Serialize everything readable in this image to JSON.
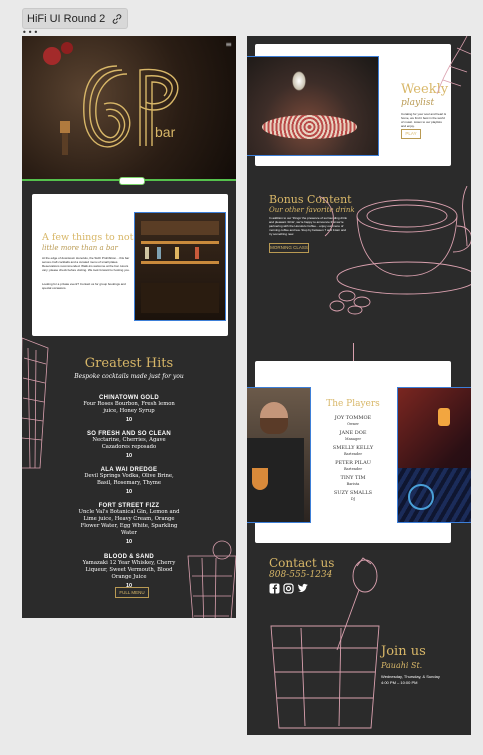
{
  "editor": {
    "frame_name": "HiFi UI Round 2",
    "frame_dots": "•••",
    "link_icon": "link-icon"
  },
  "artboard1": {
    "hero": {
      "logo": "6P",
      "bar_word": "bar"
    },
    "note_card": {
      "title": "A few things to note",
      "subtitle": "little more than a bar",
      "body": "At the edge of downtown Honolulu, the Sixth Prohibition... this bar serves craft cocktails and a curated menu of small plates. Reservations recommended. Walk-ins welcome at the bar. Hours vary; please check before visiting. We look forward to hosting you.",
      "body2": "Looking for a private event? Contact us for group bookings and special occasions."
    },
    "greatest_hits": {
      "title": "Greatest Hits",
      "subtitle": "Bespoke cocktails made just for you",
      "items": [
        {
          "name": "CHINATOWN GOLD",
          "desc": "Four Roses Bourbon, Fresh lemon juice, Honey Syrup",
          "price": "10"
        },
        {
          "name": "SO FRESH AND SO CLEAN",
          "desc": "Nectarine, Cherries, Agave Cazadores reposado",
          "price": "10"
        },
        {
          "name": "ALA WAI DREDGE",
          "desc": "Devil Springs Vodka, Olive Brine, Basil, Rosemary, Thyme",
          "price": "10"
        },
        {
          "name": "FORT STREET FIZZ",
          "desc": "Uncle Val's Botanical Gin, Lemon and Lime juice, Heavy Cream, Orange Flower Water, Egg White, Sparkling Water",
          "price": "10"
        },
        {
          "name": "BLOOD & SAND",
          "desc": "Yamazaki 12 Year Whiskey, Cherry Liqueur, Sweet Vermouth, Blood Orange Juice",
          "price": "10"
        }
      ],
      "button": "FULL MENU"
    }
  },
  "artboard2": {
    "weekly": {
      "title": "Weekly",
      "subtitle": "playlist",
      "body": "Curating for your soul and heart & home, we find it best in the world of music. Listen to our playlists and enjoy.",
      "button": "PLAY"
    },
    "bonus": {
      "title": "Bonus Content",
      "subtitle": "Our other favorite drink",
      "body": "In addition to our 'things' the presence of surrounding drink and pleasant 'drink', we're happy to announce that we're partnering with the Honolulu Coffee... enjoy our menu of morning coffee and tea. Stop by between 7 and 11am and try something new.",
      "button": "MORNING CLASS"
    },
    "players": {
      "title": "The Players",
      "list": [
        {
          "name": "JOY TOMMOE",
          "role": "Owner"
        },
        {
          "name": "JANE DOE",
          "role": "Manager"
        },
        {
          "name": "SMELLY KELLY",
          "role": "Bartender"
        },
        {
          "name": "PETER PILAU",
          "role": "Bartender"
        },
        {
          "name": "TINY TIM",
          "role": "Barista"
        },
        {
          "name": "SUZY SMALLS",
          "role": "DJ"
        }
      ]
    },
    "contact": {
      "title": "Contact us",
      "phone": "808-555-1234",
      "icons": [
        "facebook-icon",
        "instagram-icon",
        "twitter-icon"
      ]
    },
    "join": {
      "title": "Join us",
      "place": "Pauahi St.",
      "days": "Wednesday, Thursday, & Sunday",
      "hours": "4:00 PM – 10:00 PM"
    }
  }
}
